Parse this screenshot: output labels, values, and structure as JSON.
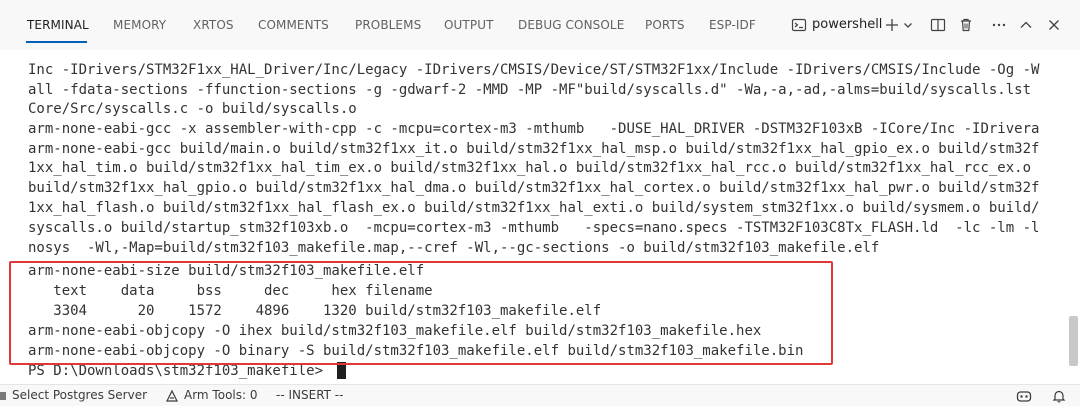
{
  "tabs": [
    {
      "label": "TERMINAL",
      "active": true
    },
    {
      "label": "MEMORY"
    },
    {
      "label": "XRTOS"
    },
    {
      "label": "COMMENTS"
    },
    {
      "label": "PROBLEMS"
    },
    {
      "label": "OUTPUT"
    },
    {
      "label": "DEBUG CONSOLE"
    },
    {
      "label": "PORTS"
    },
    {
      "label": "ESP-IDF"
    }
  ],
  "toolbar": {
    "shell_label": "powershell",
    "icons": [
      "terminal-icon",
      "plus-icon",
      "chevron-down-icon",
      "split-icon",
      "trash-icon",
      "more-icon",
      "maximize-icon",
      "close-icon"
    ]
  },
  "terminal": {
    "lines": [
      "Inc -IDrivers/STM32F1xx_HAL_Driver/Inc/Legacy -IDrivers/CMSIS/Device/ST/STM32F1xx/Include -IDrivers/CMSIS/Include -Og -W",
      "all -fdata-sections -ffunction-sections -g -gdwarf-2 -MMD -MP -MF\"build/syscalls.d\" -Wa,-a,-ad,-alms=build/syscalls.lst",
      "Core/Src/syscalls.c -o build/syscalls.o",
      "arm-none-eabi-gcc -x assembler-with-cpp -c -mcpu=cortex-m3 -mthumb   -DUSE_HAL_DRIVER -DSTM32F103xB -ICore/Inc -IDrivera",
      "arm-none-eabi-gcc build/main.o build/stm32f1xx_it.o build/stm32f1xx_hal_msp.o build/stm32f1xx_hal_gpio_ex.o build/stm32f",
      "1xx_hal_tim.o build/stm32f1xx_hal_tim_ex.o build/stm32f1xx_hal.o build/stm32f1xx_hal_rcc.o build/stm32f1xx_hal_rcc_ex.o",
      "build/stm32f1xx_hal_gpio.o build/stm32f1xx_hal_dma.o build/stm32f1xx_hal_cortex.o build/stm32f1xx_hal_pwr.o build/stm32f",
      "1xx_hal_flash.o build/stm32f1xx_hal_flash_ex.o build/stm32f1xx_hal_exti.o build/system_stm32f1xx.o build/sysmem.o build/",
      "syscalls.o build/startup_stm32f103xb.o  -mcpu=cortex-m3 -mthumb   -specs=nano.specs -TSTM32F103C8Tx_FLASH.ld  -lc -lm -l",
      "nosys  -Wl,-Map=build/stm32f103_makefile.map,--cref -Wl,--gc-sections -o build/stm32f103_makefile.elf",
      "arm-none-eabi-size build/stm32f103_makefile.elf",
      "   text    data     bss     dec     hex filename",
      "   3304      20    1572    4896    1320 build/stm32f103_makefile.elf",
      "arm-none-eabi-objcopy -O ihex build/stm32f103_makefile.elf build/stm32f103_makefile.hex",
      "arm-none-eabi-objcopy -O binary -S build/stm32f103_makefile.elf build/stm32f103_makefile.bin",
      "PS D:\\Downloads\\stm32f103_makefile> "
    ],
    "highlight_color": "#e03838"
  },
  "statusbar": {
    "postgres": "Select Postgres Server",
    "arm_tools": "Arm Tools: 0",
    "mode": "-- INSERT --"
  }
}
